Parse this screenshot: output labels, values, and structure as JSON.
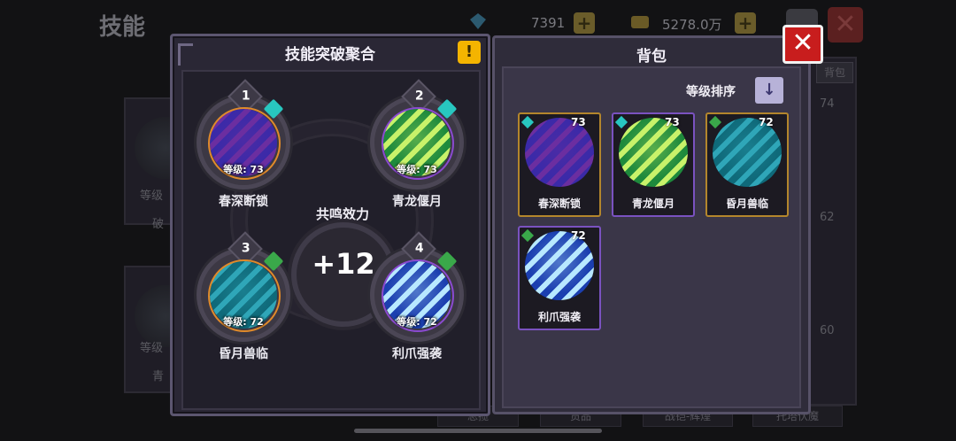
{
  "background": {
    "title": "技能",
    "gems": "7391",
    "gold": "5278.0万",
    "behind_skill_texts": [
      "等级",
      "破",
      "等级",
      "青"
    ],
    "behind_levels": [
      "74",
      "62",
      "60"
    ],
    "behind_tab": "背包",
    "bottom_tabs": [
      "总揽",
      "贡品",
      "战铠-辉煌",
      "托塔伏魔"
    ]
  },
  "fuse_panel": {
    "title": "技能突破聚合",
    "info_icon": "exclamation-icon",
    "center_label": "共鸣效力",
    "center_value": "+12",
    "slots": [
      {
        "number": "1",
        "level": "等级: 73",
        "name": "春深断锁",
        "badge": "diamond",
        "colors": [
          "#3a2aa8",
          "#6b2ea0",
          "#1a7fb8"
        ]
      },
      {
        "number": "2",
        "level": "等级: 73",
        "name": "青龙偃月",
        "badge": "diamond",
        "colors": [
          "#1e8a3c",
          "#c8f26a",
          "#2a6a50"
        ]
      },
      {
        "number": "3",
        "level": "等级: 72",
        "name": "昏月兽临",
        "badge": "arrow",
        "colors": [
          "#0f6a7a",
          "#2fa6b8",
          "#18306a"
        ]
      },
      {
        "number": "4",
        "level": "等级: 72",
        "name": "利爪强袭",
        "badge": "arrow",
        "colors": [
          "#1b3fb0",
          "#b8e8ff",
          "#2f7be0"
        ]
      }
    ]
  },
  "backpack": {
    "title": "背包",
    "sort_label": "等级排序",
    "sort_icon": "arrow-down-icon",
    "items": [
      {
        "level": "73",
        "name": "春深断锁",
        "frame": "gold",
        "colors": [
          "#3a2aa8",
          "#6b2ea0",
          "#1a7fb8"
        ]
      },
      {
        "level": "73",
        "name": "青龙偃月",
        "frame": "purple",
        "colors": [
          "#1e8a3c",
          "#c8f26a",
          "#2a6a50"
        ]
      },
      {
        "level": "72",
        "name": "昏月兽临",
        "frame": "gold",
        "colors": [
          "#0f6a7a",
          "#2fa6b8",
          "#18306a"
        ]
      },
      {
        "level": "72",
        "name": "利爪强袭",
        "frame": "purple",
        "colors": [
          "#1b3fb0",
          "#b8e8ff",
          "#2f7be0"
        ]
      }
    ]
  },
  "close_icon": "close-x-icon"
}
